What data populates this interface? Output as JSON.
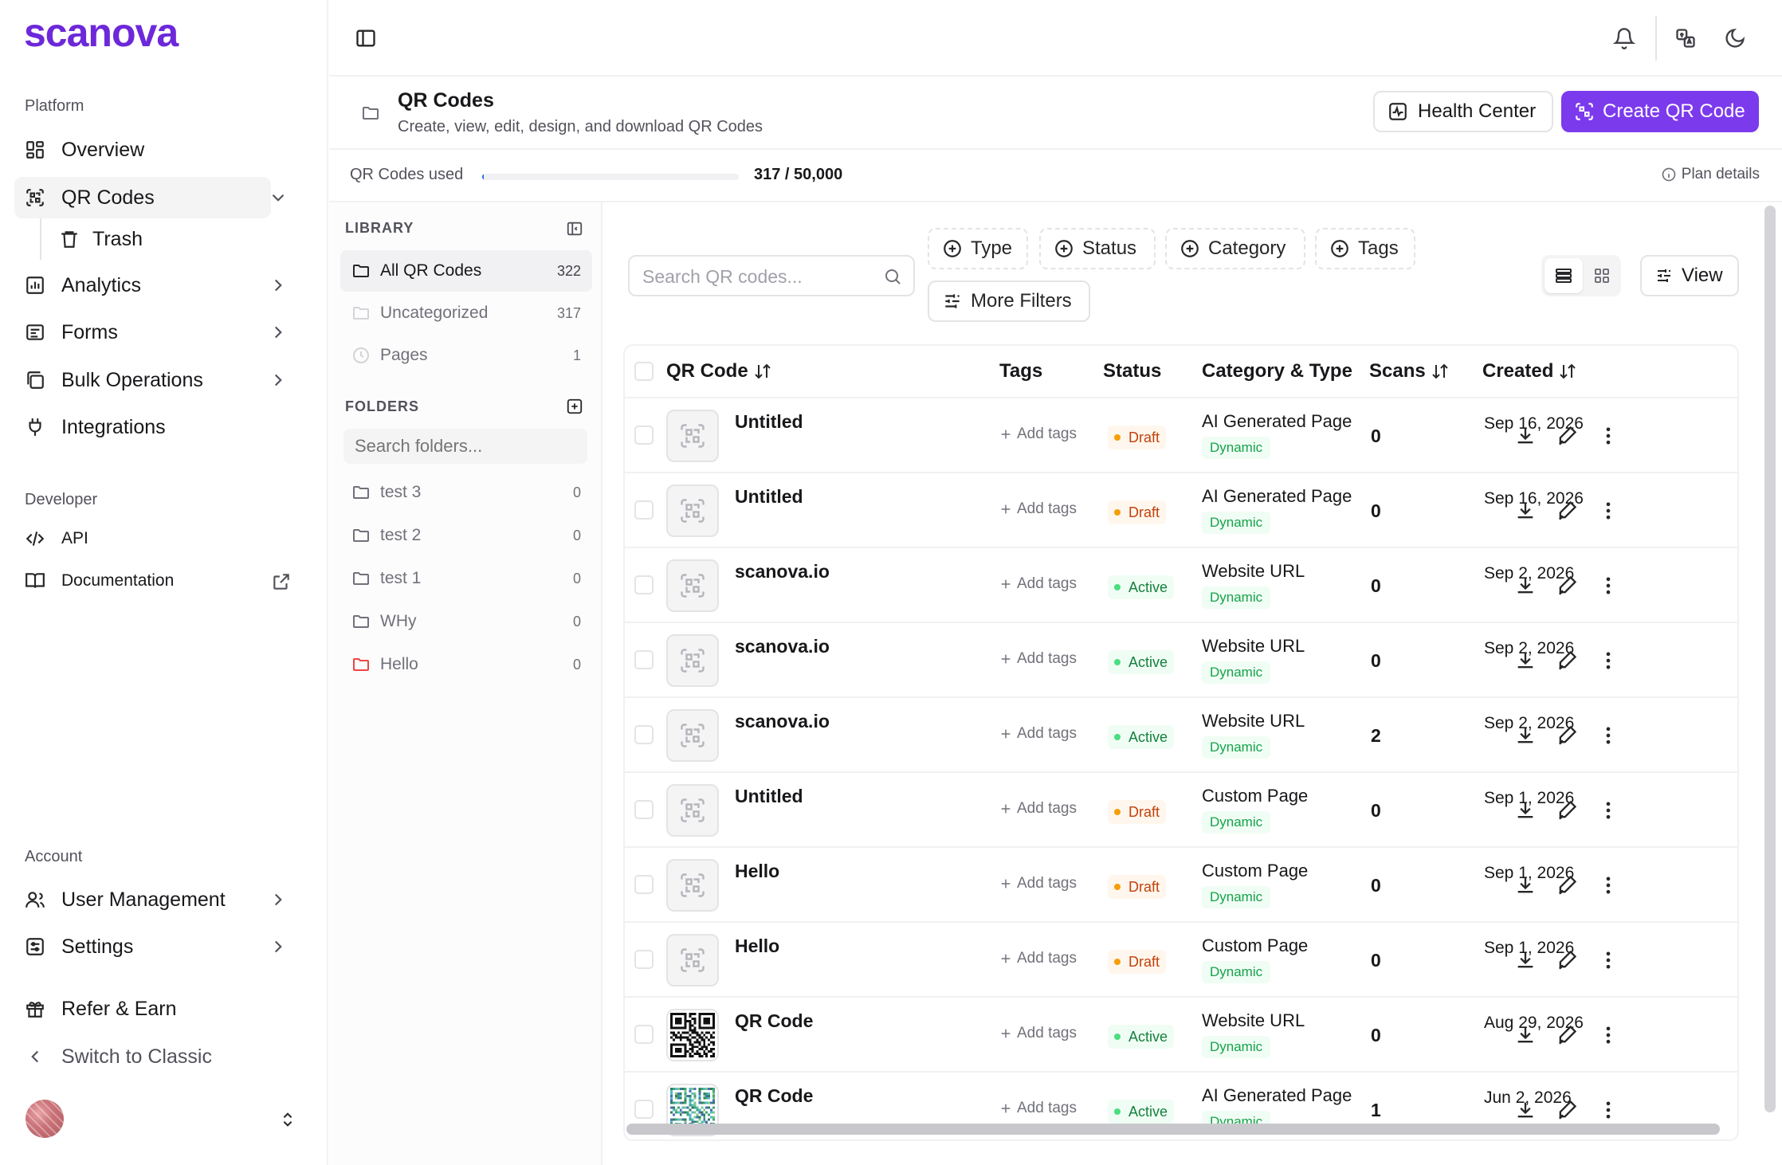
{
  "brand": {
    "name": "scanova",
    "color": "#7c3aed"
  },
  "sidebar": {
    "platform_label": "Platform",
    "developer_label": "Developer",
    "account_label": "Account",
    "items": {
      "overview": "Overview",
      "qr_codes": "QR Codes",
      "trash": "Trash",
      "analytics": "Analytics",
      "forms": "Forms",
      "bulk_operations": "Bulk Operations",
      "integrations": "Integrations",
      "api": "API",
      "documentation": "Documentation",
      "user_management": "User Management",
      "settings": "Settings",
      "refer_earn": "Refer & Earn",
      "switch_classic": "Switch to Classic"
    }
  },
  "header": {
    "title": "QR Codes",
    "subtitle": "Create, view, edit, design, and download QR Codes",
    "health_center": "Health Center",
    "create_button": "Create QR Code"
  },
  "usage": {
    "label": "QR Codes used",
    "count": "317 / 50,000",
    "used": 317,
    "limit": 50000,
    "plan_details": "Plan details"
  },
  "library": {
    "heading": "LIBRARY",
    "items": [
      {
        "label": "All QR Codes",
        "count": "322"
      },
      {
        "label": "Uncategorized",
        "count": "317"
      },
      {
        "label": "Pages",
        "count": "1"
      }
    ],
    "folders_heading": "FOLDERS",
    "folder_search_placeholder": "Search folders...",
    "folders": [
      {
        "label": "test 3",
        "count": "0",
        "color": "#71717a"
      },
      {
        "label": "test 2",
        "count": "0",
        "color": "#71717a"
      },
      {
        "label": "test 1",
        "count": "0",
        "color": "#71717a"
      },
      {
        "label": "WHy",
        "count": "0",
        "color": "#71717a"
      },
      {
        "label": "Hello",
        "count": "0",
        "color": "#ef4444"
      }
    ]
  },
  "toolbar": {
    "search_placeholder": "Search QR codes...",
    "filters": [
      "Type",
      "Status",
      "Category",
      "Tags"
    ],
    "more_filters": "More Filters",
    "view_label": "View"
  },
  "table": {
    "columns": {
      "qr_code": "QR Code",
      "tags": "Tags",
      "status": "Status",
      "category": "Category & Type",
      "scans": "Scans",
      "created": "Created"
    },
    "add_tags_label": "Add tags",
    "rows": [
      {
        "name": "Untitled",
        "status": "Draft",
        "category": "AI Generated Page",
        "type": "Dynamic",
        "scans": "0",
        "created": "Sep 16, 2026",
        "thumb": "placeholder"
      },
      {
        "name": "Untitled",
        "status": "Draft",
        "category": "AI Generated Page",
        "type": "Dynamic",
        "scans": "0",
        "created": "Sep 16, 2026",
        "thumb": "placeholder"
      },
      {
        "name": "scanova.io",
        "status": "Active",
        "category": "Website URL",
        "type": "Dynamic",
        "scans": "0",
        "created": "Sep 2, 2026",
        "thumb": "placeholder"
      },
      {
        "name": "scanova.io",
        "status": "Active",
        "category": "Website URL",
        "type": "Dynamic",
        "scans": "0",
        "created": "Sep 2, 2026",
        "thumb": "placeholder"
      },
      {
        "name": "scanova.io",
        "status": "Active",
        "category": "Website URL",
        "type": "Dynamic",
        "scans": "2",
        "created": "Sep 2, 2026",
        "thumb": "placeholder"
      },
      {
        "name": "Untitled",
        "status": "Draft",
        "category": "Custom Page",
        "type": "Dynamic",
        "scans": "0",
        "created": "Sep 1, 2026",
        "thumb": "placeholder"
      },
      {
        "name": "Hello",
        "status": "Draft",
        "category": "Custom Page",
        "type": "Dynamic",
        "scans": "0",
        "created": "Sep 1, 2026",
        "thumb": "placeholder"
      },
      {
        "name": "Hello",
        "status": "Draft",
        "category": "Custom Page",
        "type": "Dynamic",
        "scans": "0",
        "created": "Sep 1, 2026",
        "thumb": "placeholder"
      },
      {
        "name": "QR Code",
        "status": "Active",
        "category": "Website URL",
        "type": "Dynamic",
        "scans": "0",
        "created": "Aug 29, 2026",
        "thumb": "qr-black"
      },
      {
        "name": "QR Code",
        "status": "Active",
        "category": "AI Generated Page",
        "type": "Dynamic",
        "scans": "1",
        "created": "Jun 2, 2026",
        "thumb": "qr-color"
      }
    ]
  },
  "colors": {
    "accent": "#7c3aed",
    "draft_text": "#c2410c",
    "draft_bg": "#fff7ed",
    "draft_dot": "#f59e0b",
    "active_text": "#15803d",
    "active_bg": "#f0fdf4",
    "active_dot": "#4ade80",
    "usage_fill": "#2563eb"
  }
}
